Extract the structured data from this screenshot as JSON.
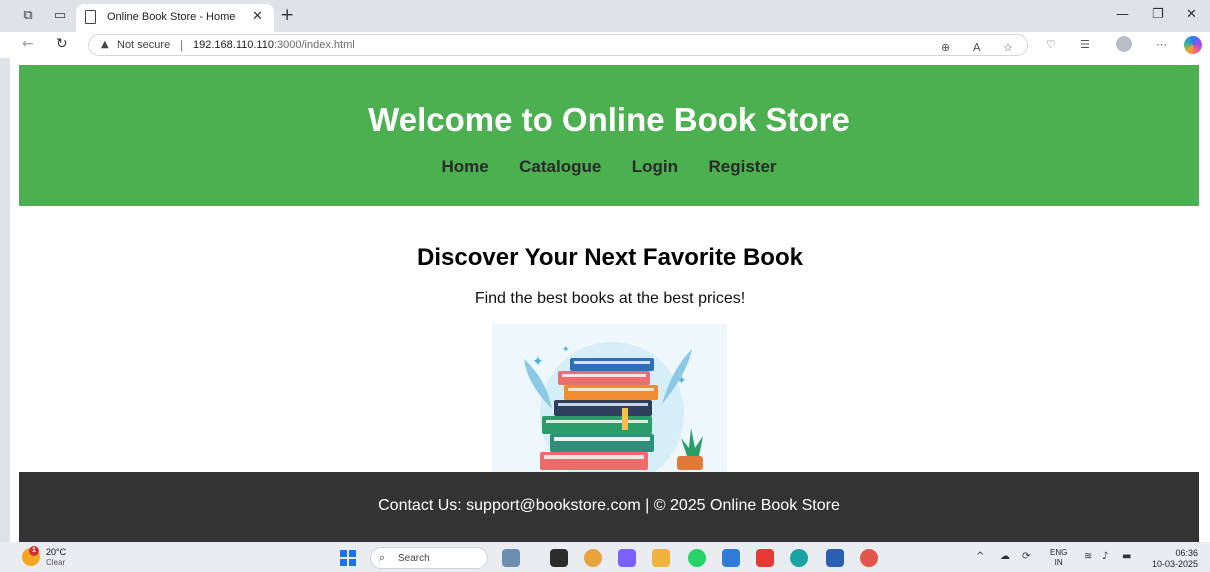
{
  "browser": {
    "tab_title": "Online Book Store - Home",
    "security_label": "Not secure",
    "url_host": "192.168.110.110",
    "url_path": ":3000/index.html"
  },
  "site": {
    "title": "Welcome to Online Book Store",
    "nav": [
      "Home",
      "Catalogue",
      "Login",
      "Register"
    ],
    "hero_heading": "Discover Your Next Favorite Book",
    "hero_subtitle": "Find the best books at the best prices!",
    "footer": "Contact Us: support@bookstore.com | © 2025 Online Book Store",
    "colors": {
      "header": "#4caf50",
      "footer": "#333333"
    }
  },
  "taskbar": {
    "weather_temp": "20°C",
    "weather_cond": "Clear",
    "weather_badge": "1",
    "search_label": "Search",
    "lang_primary": "ENG",
    "lang_secondary": "IN",
    "time": "06:36",
    "date": "10-03-2025"
  }
}
